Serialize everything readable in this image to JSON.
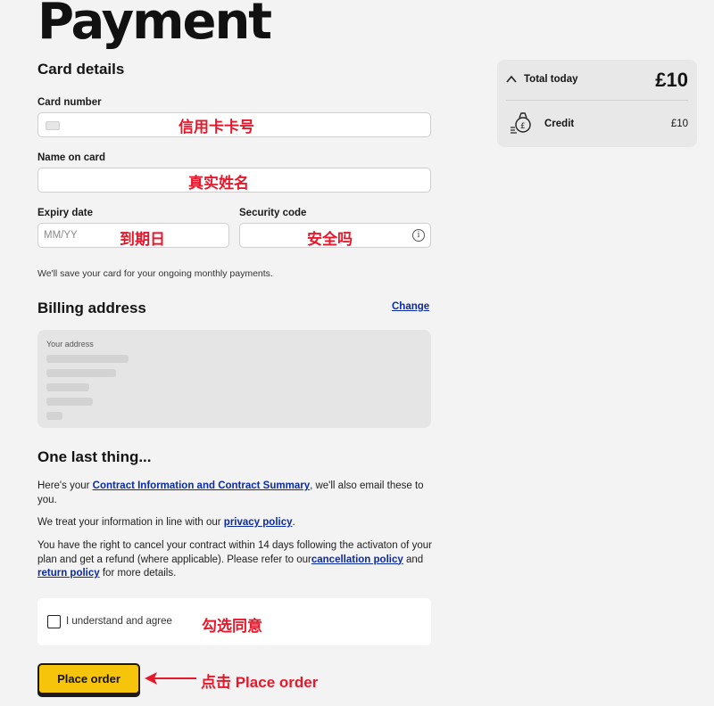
{
  "page": {
    "title": "Payment"
  },
  "card_details": {
    "heading": "Card details",
    "card_number_label": "Card number",
    "name_label": "Name on card",
    "expiry_label": "Expiry date",
    "expiry_placeholder": "MM/YY",
    "security_label": "Security code",
    "save_note": "We'll save your card for your ongoing monthly payments."
  },
  "annotations": {
    "card_number": "信用卡卡号",
    "name": "真实姓名",
    "expiry": "到期日",
    "security": "安全吗",
    "agree": "勾选同意",
    "place_order": "点击 Place order"
  },
  "billing": {
    "heading": "Billing address",
    "change_link": "Change",
    "address_label": "Your address"
  },
  "last_thing": {
    "heading": "One last thing...",
    "p1_pre": "Here's your ",
    "p1_link": "Contract Information and Contract Summary",
    "p1_post": ", we'll also email these to you.",
    "p2_pre": "We treat your information in line with our ",
    "p2_link": "privacy policy",
    "p2_post": ".",
    "p3_pre": "You have the right to cancel your contract within 14 days following the activaton of your plan and get a refund (where applicable). Please refer to our",
    "p3_link1": "cancellation policy",
    "p3_mid": " and ",
    "p3_link2": "return policy",
    "p3_post": " for more details.",
    "agree_label": "I understand and agree"
  },
  "actions": {
    "place_order": "Place order"
  },
  "summary": {
    "total_label": "Total today",
    "total_value": "£10",
    "credit_label": "Credit",
    "credit_value": "£10"
  },
  "colors": {
    "annotation": "#e5192b",
    "button": "#f6c40a",
    "link": "#0b2aa6"
  }
}
